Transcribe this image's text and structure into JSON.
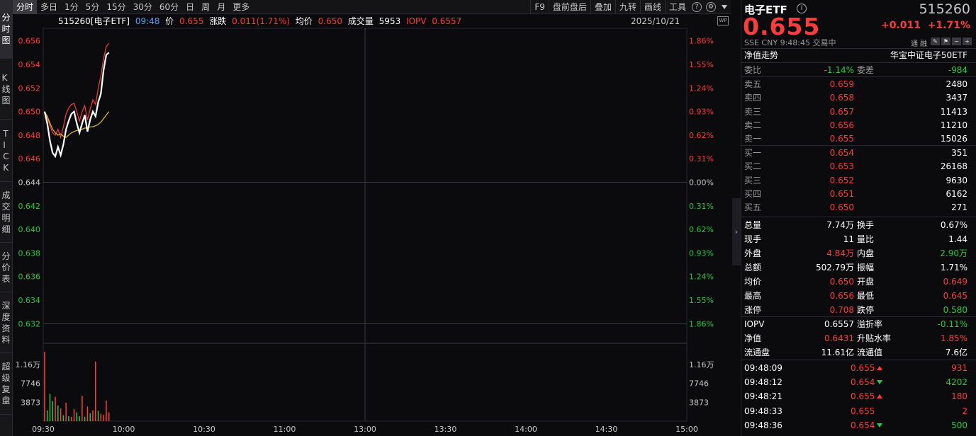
{
  "left_tabs": [
    {
      "label": "分时图",
      "active": true
    },
    {
      "label": "K线图",
      "active": false
    },
    {
      "label": "TICK",
      "active": false
    },
    {
      "label": "成交明细",
      "active": false
    },
    {
      "label": "分价表",
      "active": false
    },
    {
      "label": "深度资料",
      "active": false
    },
    {
      "label": "超级复盘",
      "active": false
    }
  ],
  "period_tabs": [
    "分时",
    "多日",
    "1分",
    "5分",
    "15分",
    "30分",
    "60分",
    "日",
    "周",
    "月",
    "更多"
  ],
  "period_active": "分时",
  "toolbar": {
    "f9": "F9",
    "premarket": "盘前盘后",
    "overlay": "叠加",
    "jiuzhuan": "九转",
    "draw": "画线",
    "tools": "工具",
    "help_icon_char": "?"
  },
  "info": {
    "code_name": "515260[电子ETF]",
    "time": "09:48",
    "price_label": "价",
    "price": "0.655",
    "change_label": "涨跌",
    "change": "0.011(1.71%)",
    "avg_label": "均价",
    "avg": "0.650",
    "volume_label": "成交量",
    "volume": "5953",
    "iopv_label": "IOPV",
    "iopv": "0.6557",
    "date": "2025/10/21",
    "wp_icon_text": "WP"
  },
  "chart_data": {
    "type": "line",
    "prev_close": 0.644,
    "ylim": [
      0.631,
      0.657
    ],
    "price_ticks": [
      "0.656",
      "0.654",
      "0.652",
      "0.650",
      "0.648",
      "0.646",
      "0.644",
      "0.642",
      "0.640",
      "0.638",
      "0.636",
      "0.634",
      "0.632"
    ],
    "pct_ticks": [
      "1.86%",
      "1.55%",
      "1.24%",
      "0.93%",
      "0.62%",
      "0.31%",
      "0.00%",
      "0.31%",
      "0.62%",
      "0.93%",
      "1.24%",
      "1.55%",
      "1.86%"
    ],
    "volume_ticks": [
      "1.16万",
      "7746",
      "3873"
    ],
    "volume_max": 15500,
    "time_ticks": [
      "09:30",
      "10:00",
      "10:30",
      "11:00",
      "13:00",
      "13:30",
      "14:00",
      "14:30",
      "15:00"
    ],
    "total_minutes": 240,
    "series": [
      {
        "color": "#ffffff",
        "values": [
          0.65,
          0.649,
          0.6475,
          0.6465,
          0.6462,
          0.647,
          0.6463,
          0.6472,
          0.6485,
          0.6492,
          0.6498,
          0.65,
          0.649,
          0.6482,
          0.649,
          0.6497,
          0.6483,
          0.6493,
          0.65,
          0.6496,
          0.6508,
          0.6515,
          0.6535,
          0.6548,
          0.655
        ]
      },
      {
        "color": "#e6c229",
        "values": [
          0.65,
          0.6496,
          0.649,
          0.6485,
          0.6482,
          0.648,
          0.6481,
          0.6479,
          0.6478,
          0.648,
          0.6482,
          0.6483,
          0.6484,
          0.6484,
          0.6485,
          0.6486,
          0.6486,
          0.6487,
          0.6487,
          0.6488,
          0.6489,
          0.6491,
          0.6494,
          0.6497,
          0.65
        ]
      },
      {
        "color": "#ff3b3b",
        "values": [
          0.65,
          0.6495,
          0.6488,
          0.6482,
          0.648,
          0.6485,
          0.6478,
          0.6487,
          0.6498,
          0.6503,
          0.6506,
          0.6507,
          0.65,
          0.6492,
          0.65,
          0.6505,
          0.6493,
          0.6502,
          0.651,
          0.6506,
          0.652,
          0.653,
          0.6545,
          0.6555,
          0.6558
        ]
      }
    ],
    "volumes": [
      14200,
      2200,
      5600,
      4100,
      5000,
      3200,
      2600,
      1200,
      3800,
      1000,
      900,
      2500,
      1800,
      1000,
      5200,
      900,
      3000,
      1600,
      2200,
      12200,
      2100,
      1500,
      1300,
      4200,
      1800
    ],
    "volume_up": [
      true,
      false,
      false,
      false,
      true,
      false,
      true,
      false,
      true,
      false,
      true,
      true,
      false,
      false,
      true,
      false,
      true,
      false,
      true,
      true,
      false,
      true,
      true,
      true,
      true
    ]
  },
  "quote": {
    "name": "电子ETF",
    "code": "515260",
    "price": "0.655",
    "change": "+0.011",
    "change_pct": "+1.71%",
    "exchange": "SSE",
    "currency": "CNY",
    "time": "9:48:45",
    "status": "交易中",
    "btn1": "通",
    "btn2": "融",
    "nav_trend_label": "净值走势",
    "index_name": "华宝中证电子50ETF"
  },
  "ratio": {
    "wb_label": "委比",
    "wb": "-1.14%",
    "wc_label": "委差",
    "wc": "-984"
  },
  "asks": [
    {
      "label": "卖五",
      "price": "0.659",
      "vol": "2480"
    },
    {
      "label": "卖四",
      "price": "0.658",
      "vol": "3437"
    },
    {
      "label": "卖三",
      "price": "0.657",
      "vol": "11413"
    },
    {
      "label": "卖二",
      "price": "0.656",
      "vol": "11210"
    },
    {
      "label": "卖一",
      "price": "0.655",
      "vol": "15026"
    }
  ],
  "bids": [
    {
      "label": "买一",
      "price": "0.654",
      "vol": "351"
    },
    {
      "label": "买二",
      "price": "0.653",
      "vol": "26168"
    },
    {
      "label": "买三",
      "price": "0.652",
      "vol": "9630"
    },
    {
      "label": "买四",
      "price": "0.651",
      "vol": "6162"
    },
    {
      "label": "买五",
      "price": "0.650",
      "vol": "271"
    }
  ],
  "stats": [
    {
      "l1": "总量",
      "v1": "7.74万",
      "c1": "white",
      "l2": "换手",
      "v2": "0.67%",
      "c2": "white"
    },
    {
      "l1": "现手",
      "v1": "11",
      "c1": "white",
      "l2": "量比",
      "v2": "1.44",
      "c2": "white"
    },
    {
      "l1": "外盘",
      "v1": "4.84万",
      "c1": "red",
      "l2": "内盘",
      "v2": "2.90万",
      "c2": "green"
    },
    {
      "l1": "总额",
      "v1": "502.79万",
      "c1": "white",
      "l2": "振幅",
      "v2": "1.71%",
      "c2": "white"
    },
    {
      "l1": "均价",
      "v1": "0.650",
      "c1": "red",
      "l2": "开盘",
      "v2": "0.649",
      "c2": "red"
    },
    {
      "l1": "最高",
      "v1": "0.656",
      "c1": "red",
      "l2": "最低",
      "v2": "0.645",
      "c2": "red"
    },
    {
      "l1": "涨停",
      "v1": "0.708",
      "c1": "red",
      "l2": "跌停",
      "v2": "0.580",
      "c2": "green"
    }
  ],
  "stats2": [
    {
      "l1": "IOPV",
      "v1": "0.6557",
      "c1": "white",
      "l2": "溢折率",
      "v2": "-0.11%",
      "c2": "green"
    },
    {
      "l1": "净值",
      "v1": "0.6431",
      "c1": "red",
      "l2": "升贴水率",
      "v2": "1.85%",
      "c2": "red"
    },
    {
      "l1": "流通盘",
      "v1": "11.61亿",
      "c1": "white",
      "l2": "流通值",
      "v2": "7.6亿",
      "c2": "white"
    }
  ],
  "ticks": [
    {
      "time": "09:48:09",
      "price": "0.655",
      "dir": "up",
      "vol": "931",
      "vc": "red"
    },
    {
      "time": "09:48:12",
      "price": "0.654",
      "dir": "down",
      "vol": "4202",
      "vc": "green"
    },
    {
      "time": "09:48:21",
      "price": "0.655",
      "dir": "up",
      "vol": "180",
      "vc": "red"
    },
    {
      "time": "09:48:33",
      "price": "0.655",
      "dir": "none",
      "vol": "2",
      "vc": "red"
    },
    {
      "time": "09:48:36",
      "price": "0.654",
      "dir": "down",
      "vol": "500",
      "vc": "green"
    }
  ],
  "colors": {
    "up": "#ff3b3b",
    "down": "#27c93f",
    "grid": "#2a2a2e",
    "axis_neutral": "#c8c8c8"
  }
}
